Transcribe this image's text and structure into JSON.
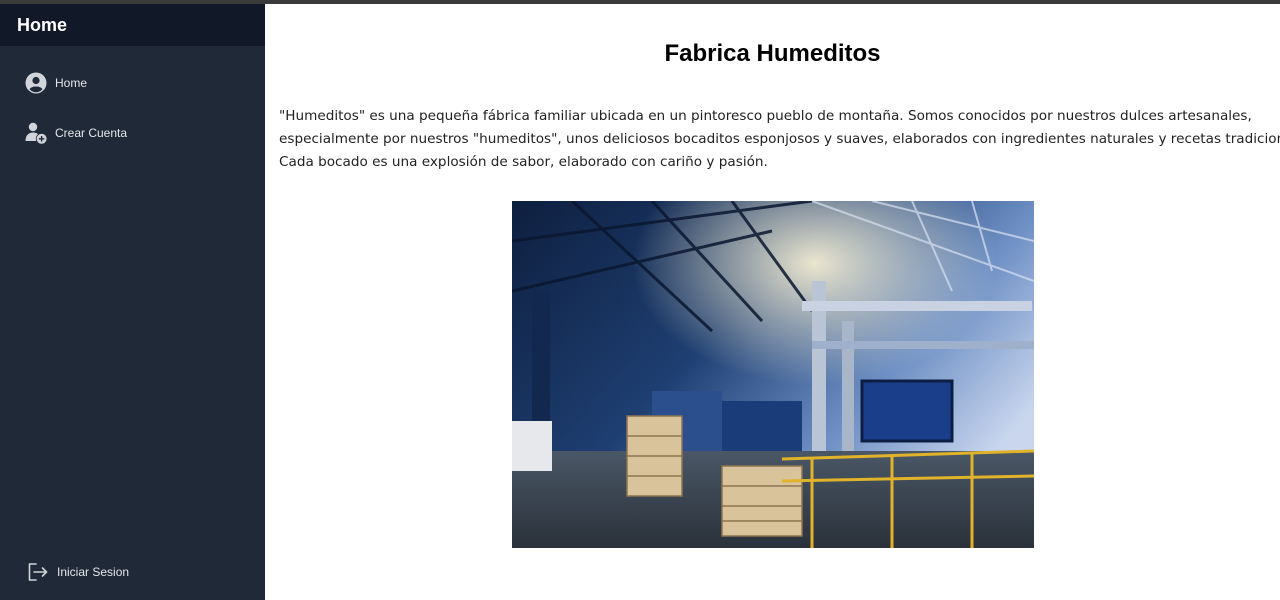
{
  "sidebar": {
    "title": "Home",
    "items": [
      {
        "label": "Home",
        "icon": "user-circle-icon"
      },
      {
        "label": "Crear Cuenta",
        "icon": "add-user-icon"
      }
    ],
    "footer_item": {
      "label": "Iniciar Sesion",
      "icon": "sign-in-icon"
    }
  },
  "main": {
    "title": "Fabrica Humeditos",
    "description_lines": [
      "\"Humeditos\" es una pequeña fábrica familiar ubicada en un pintoresco pueblo de montaña. Somos conocidos por nuestros dulces artesanales,",
      "especialmente por nuestros \"humeditos\", unos deliciosos bocaditos esponjosos y suaves, elaborados con ingredientes naturales y recetas tradicionales.",
      "Cada bocado es una explosión de sabor, elaborado con cariño y pasión."
    ]
  },
  "colors": {
    "sidebar_bg": "#1f2937",
    "sidebar_header_bg": "#111827",
    "sidebar_text": "#e5e7eb"
  }
}
